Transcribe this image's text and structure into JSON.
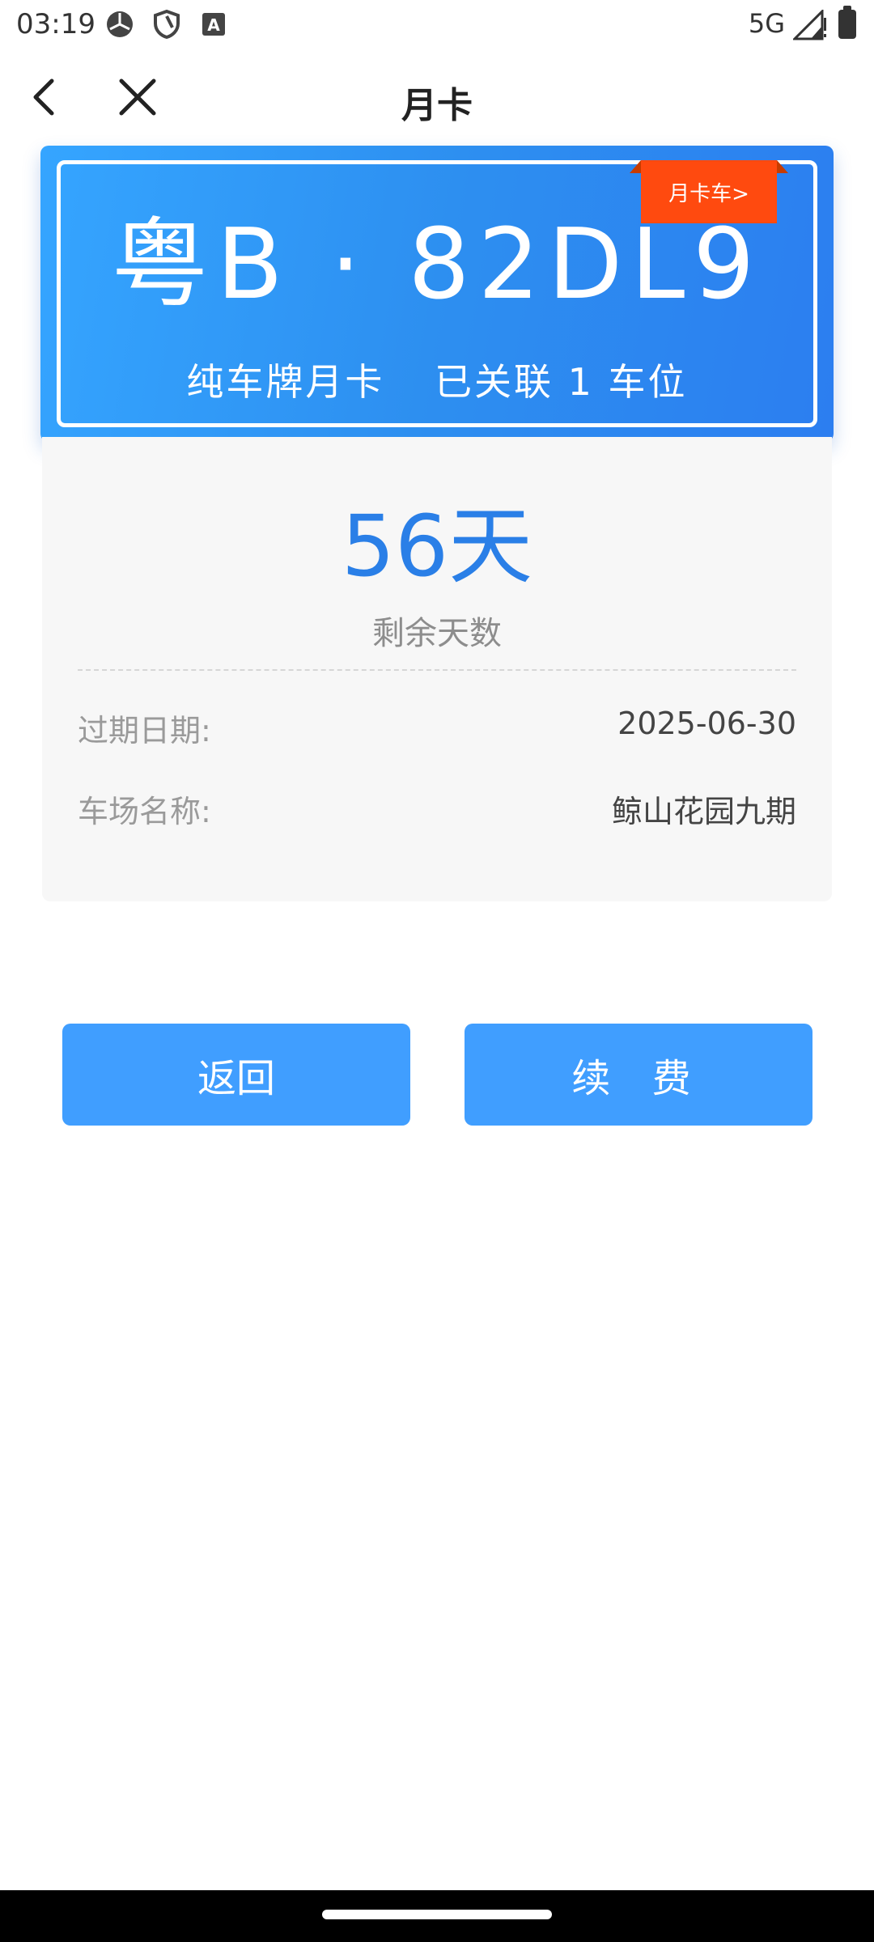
{
  "status_bar": {
    "time": "03:19",
    "network": "5G",
    "icons": [
      "sync-icon",
      "shield-icon",
      "font-a-icon",
      "signal-icon",
      "battery-icon"
    ]
  },
  "header": {
    "title": "月卡",
    "back_icon": "chevron-left-icon",
    "close_icon": "close-icon"
  },
  "plate": {
    "number": "粤B · 82DL9",
    "type": "纯车牌月卡",
    "linked": "已关联 1 车位",
    "tag": "月卡车>"
  },
  "info": {
    "days_remaining": "56天",
    "days_label": "剩余天数",
    "expiry_label": "过期日期:",
    "expiry_value": "2025-06-30",
    "lot_label": "车场名称:",
    "lot_value": "鲸山花园九期"
  },
  "buttons": {
    "return": "返回",
    "renew": "续 费"
  },
  "colors": {
    "primary": "#409eff",
    "days_text": "#2a7fe7",
    "tag": "#ff4a0f"
  }
}
